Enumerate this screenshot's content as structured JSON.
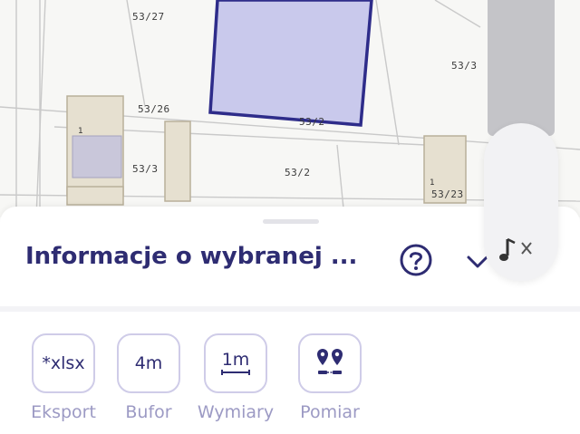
{
  "map": {
    "parcel_labels": [
      "53/27",
      "53/26",
      "53/3",
      "53/2",
      "53/3",
      "53/23",
      "53/2"
    ],
    "highlight_color": "#2e2c8a",
    "highlight_fill": "#c9c9ec"
  },
  "sheet": {
    "title": "Informacje o wybranej ...",
    "help_icon": "help-circle-icon",
    "collapse_icon": "chevron-down-icon"
  },
  "tools": [
    {
      "icon_text": "*xlsx",
      "label": "Eksport"
    },
    {
      "icon_text": "4m",
      "label": "Bufor"
    },
    {
      "icon_text": "1m",
      "label": "Wymiary"
    },
    {
      "icon_text": "",
      "label": "Pomiar",
      "icon": "pins-icon"
    }
  ],
  "colors": {
    "accent": "#2e2c72",
    "muted": "#9c9ac4",
    "border": "#cfcce8"
  }
}
